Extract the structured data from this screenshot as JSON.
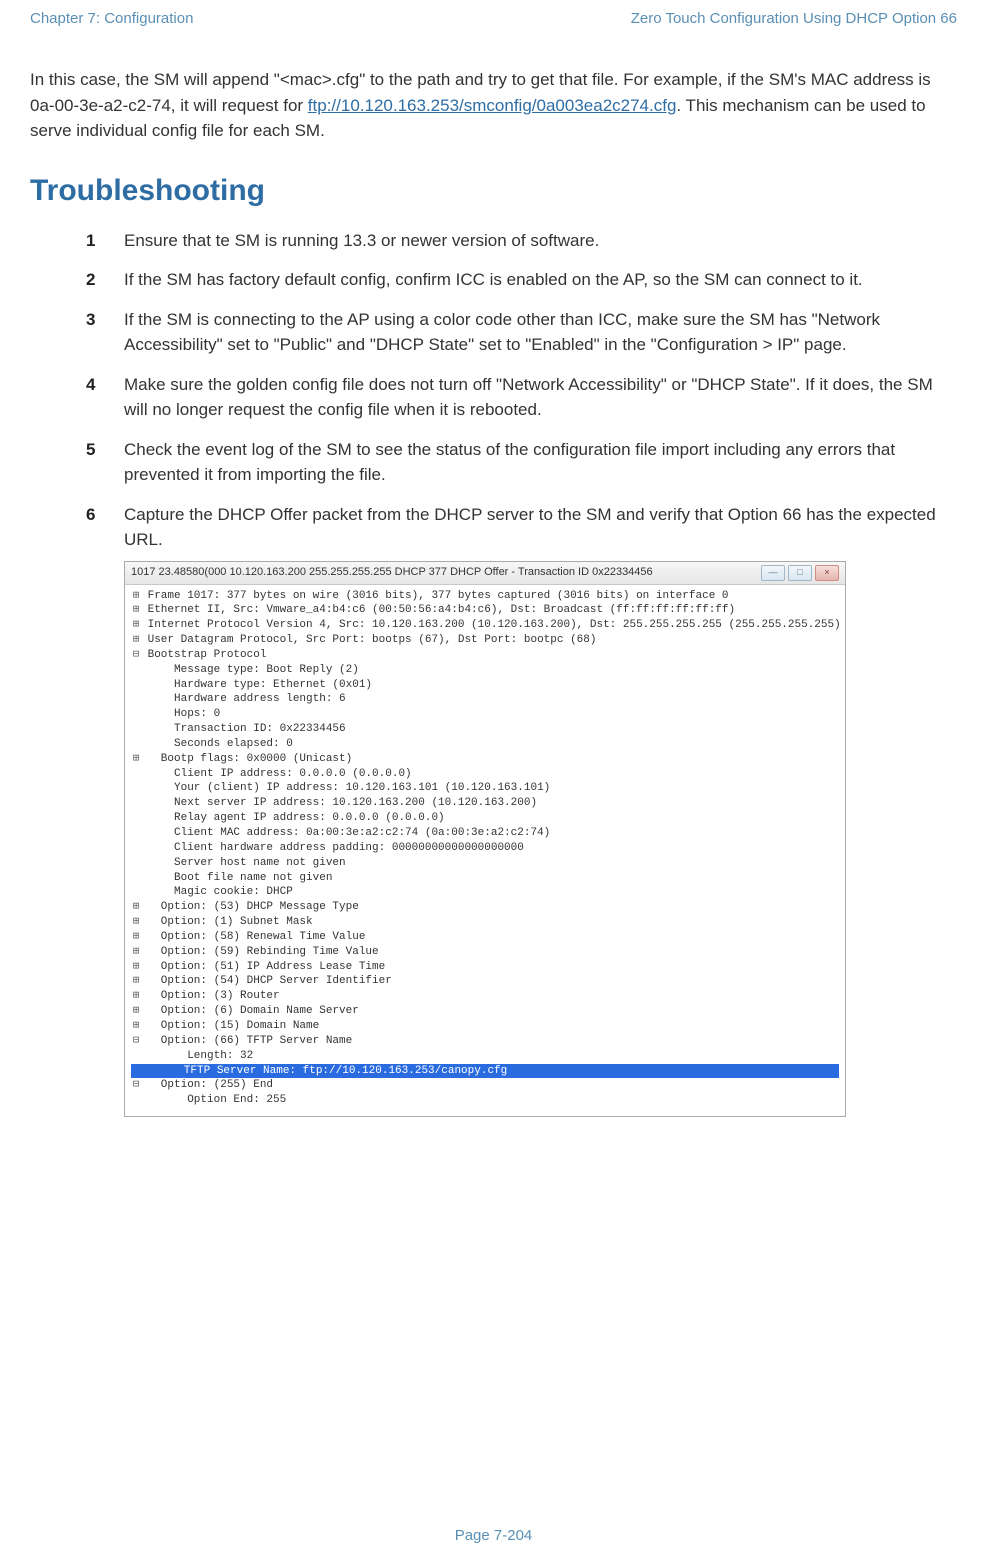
{
  "header": {
    "left": "Chapter 7:  Configuration",
    "right": "Zero Touch Configuration Using DHCP Option 66"
  },
  "intro": {
    "pre_link": "In this case, the SM will append \"<mac>.cfg\" to the path and try to get that file. For example, if the SM's MAC address is 0a-00-3e-a2-c2-74, it will request for ",
    "link": "ftp://10.120.163.253/smconfig/0a003ea2c274.cfg",
    "post_link": ". This mechanism can be used to serve individual config file for each SM."
  },
  "section_title": "Troubleshooting",
  "steps": [
    "Ensure that te SM is running 13.3 or newer version of software.",
    "If the SM has factory default config, confirm ICC is enabled on the AP, so the SM can connect to it.",
    "If the SM is connecting to the AP using a color code other than ICC, make sure the SM has \"Network Accessibility\" set to \"Public\" and \"DHCP State\" set to \"Enabled\" in the \"Configuration > IP\" page.",
    "Make sure the golden config file does not turn off \"Network Accessibility\" or \"DHCP State\". If it does, the SM will no longer request the config file when it is rebooted.",
    "Check the event log of the SM to see the status of the configuration file import including any errors that prevented it from importing the file.",
    "Capture the DHCP Offer packet from the DHCP server to the SM and verify that Option 66 has the expected URL."
  ],
  "screenshot": {
    "title": "1017 23.48580(000 10.120.163.200 255.255.255.255 DHCP 377 DHCP Offer  - Transaction ID 0x22334456",
    "winbtn_min": "—",
    "winbtn_max": "□",
    "winbtn_close": "×",
    "lines": [
      {
        "toggle": "⊞",
        "text": "Frame 1017: 377 bytes on wire (3016 bits), 377 bytes captured (3016 bits) on interface 0"
      },
      {
        "toggle": "⊞",
        "text": "Ethernet II, Src: Vmware_a4:b4:c6 (00:50:56:a4:b4:c6), Dst: Broadcast (ff:ff:ff:ff:ff:ff)"
      },
      {
        "toggle": "⊞",
        "text": "Internet Protocol Version 4, Src: 10.120.163.200 (10.120.163.200), Dst: 255.255.255.255 (255.255.255.255)"
      },
      {
        "toggle": "⊞",
        "text": "User Datagram Protocol, Src Port: bootps (67), Dst Port: bootpc (68)"
      },
      {
        "toggle": "⊟",
        "text": "Bootstrap Protocol"
      },
      {
        "toggle": " ",
        "text": "    Message type: Boot Reply (2)"
      },
      {
        "toggle": " ",
        "text": "    Hardware type: Ethernet (0x01)"
      },
      {
        "toggle": " ",
        "text": "    Hardware address length: 6"
      },
      {
        "toggle": " ",
        "text": "    Hops: 0"
      },
      {
        "toggle": " ",
        "text": "    Transaction ID: 0x22334456"
      },
      {
        "toggle": " ",
        "text": "    Seconds elapsed: 0"
      },
      {
        "toggle": "⊞",
        "text": "  Bootp flags: 0x0000 (Unicast)"
      },
      {
        "toggle": " ",
        "text": "    Client IP address: 0.0.0.0 (0.0.0.0)"
      },
      {
        "toggle": " ",
        "text": "    Your (client) IP address: 10.120.163.101 (10.120.163.101)"
      },
      {
        "toggle": " ",
        "text": "    Next server IP address: 10.120.163.200 (10.120.163.200)"
      },
      {
        "toggle": " ",
        "text": "    Relay agent IP address: 0.0.0.0 (0.0.0.0)"
      },
      {
        "toggle": " ",
        "text": "    Client MAC address: 0a:00:3e:a2:c2:74 (0a:00:3e:a2:c2:74)"
      },
      {
        "toggle": " ",
        "text": "    Client hardware address padding: 00000000000000000000"
      },
      {
        "toggle": " ",
        "text": "    Server host name not given"
      },
      {
        "toggle": " ",
        "text": "    Boot file name not given"
      },
      {
        "toggle": " ",
        "text": "    Magic cookie: DHCP"
      },
      {
        "toggle": "⊞",
        "text": "  Option: (53) DHCP Message Type"
      },
      {
        "toggle": "⊞",
        "text": "  Option: (1) Subnet Mask"
      },
      {
        "toggle": "⊞",
        "text": "  Option: (58) Renewal Time Value"
      },
      {
        "toggle": "⊞",
        "text": "  Option: (59) Rebinding Time Value"
      },
      {
        "toggle": "⊞",
        "text": "  Option: (51) IP Address Lease Time"
      },
      {
        "toggle": "⊞",
        "text": "  Option: (54) DHCP Server Identifier"
      },
      {
        "toggle": "⊞",
        "text": "  Option: (3) Router"
      },
      {
        "toggle": "⊞",
        "text": "  Option: (6) Domain Name Server"
      },
      {
        "toggle": "⊞",
        "text": "  Option: (15) Domain Name"
      },
      {
        "toggle": "⊟",
        "text": "  Option: (66) TFTP Server Name"
      },
      {
        "toggle": " ",
        "text": "      Length: 32"
      },
      {
        "toggle": " ",
        "text": "      TFTP Server Name: ftp://10.120.163.253/canopy.cfg",
        "highlight": true
      },
      {
        "toggle": "⊟",
        "text": "  Option: (255) End"
      },
      {
        "toggle": " ",
        "text": "      Option End: 255"
      }
    ]
  },
  "footer": "Page 7-204"
}
